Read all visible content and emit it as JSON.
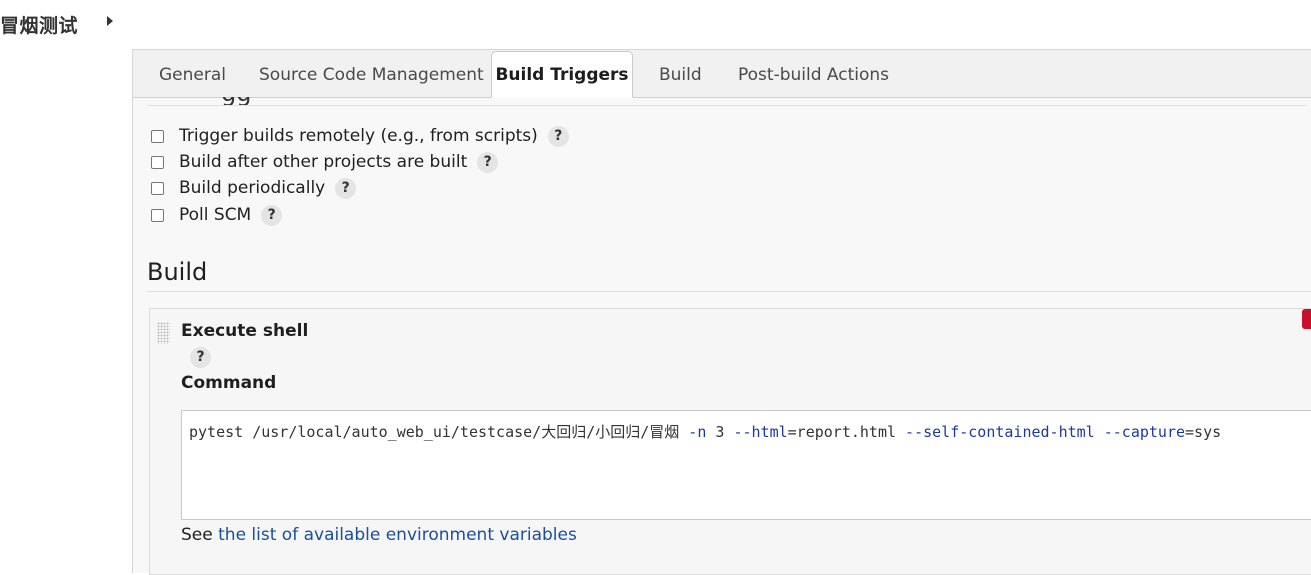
{
  "breadcrumb": {
    "job_name": "冒烟测试"
  },
  "tabs": [
    "General",
    "Source Code Management",
    "Build Triggers",
    "Build",
    "Post-build Actions"
  ],
  "triggers": {
    "options": [
      "Trigger builds remotely (e.g., from scripts)",
      "Build after other projects are built",
      "Build periodically",
      "Poll SCM"
    ],
    "help_glyph": "?"
  },
  "build": {
    "section_title": "Build",
    "step_title": "Execute shell",
    "command_label": "Command",
    "command": {
      "part1": "pytest /usr/local/auto_web_ui/testcase/大回归/小回归/冒烟 ",
      "flag_n": "-n",
      "part2": " 3 ",
      "flag_html": "--html",
      "part3": "=report.html ",
      "flag_self": "--self-contained-html",
      "part4": " ",
      "flag_capture": "--capture",
      "part5": "=sys"
    },
    "env_prefix": "See ",
    "env_link": "the list of available environment variables"
  },
  "colors": {
    "link": "#1a4d9c",
    "delete": "#c8102e",
    "flag": "#1c3a9e"
  }
}
